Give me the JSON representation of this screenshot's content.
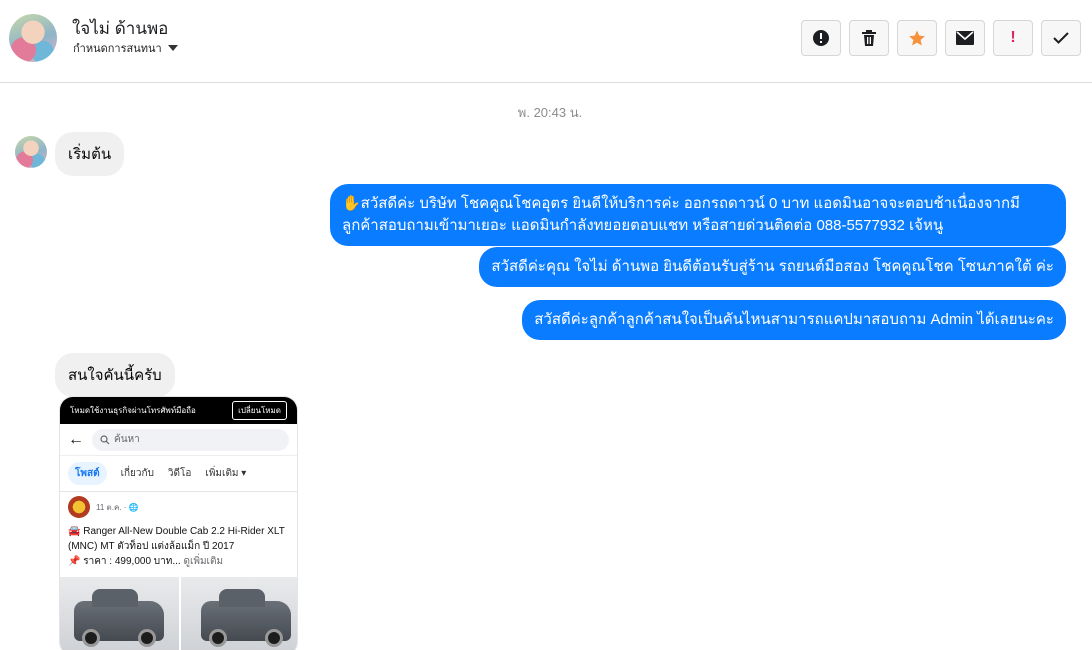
{
  "header": {
    "name": "ใจไม่ ด้านพอ",
    "assign_label": "กำหนดการสนทนา",
    "buttons": [
      {
        "id": "spam",
        "icon": "alert-circle-icon"
      },
      {
        "id": "delete",
        "icon": "trash-icon"
      },
      {
        "id": "star",
        "icon": "star-icon"
      },
      {
        "id": "mail",
        "icon": "envelope-icon"
      },
      {
        "id": "important",
        "icon": "exclamation-icon"
      },
      {
        "id": "done",
        "icon": "check-icon"
      }
    ],
    "star_color": "#f7923a",
    "important_color": "#e0245e"
  },
  "conversation": {
    "timestamp": "พ. 20:43 น.",
    "messages": [
      {
        "from": "customer",
        "text": "เริ่มต้น"
      },
      {
        "from": "page",
        "text": "✋สวัสดีค่ะ บริษัท โชคคูณโชคอุตร ยินดีให้บริการค่ะ ออกรถดาวน์ 0 บาท แอดมินอาจจะตอบช้าเนื่องจากมีลูกค้าสอบถามเข้ามาเยอะ แอดมินกำลังทยอยตอบแชท หรือสายด่วนติดต่อ 088-5577932 เจ้หนู"
      },
      {
        "from": "page",
        "text": "สวัสดีค่ะคุณ ใจไม่ ด้านพอ ยินดีต้อนรับสู่ร้าน รถยนต์มือสอง โชคคูณโชค โซนภาคใต้ ค่ะ"
      },
      {
        "from": "page",
        "text": "สวัสดีค่ะลูกค้าลูกค้าสนใจเป็นคันไหนสามารถแคปมาสอบถาม Admin ได้เลยนะคะ"
      },
      {
        "from": "customer",
        "text": "สนใจคันนี้ครับ"
      }
    ],
    "bubble_color_out": "#0a7cff",
    "bubble_color_in": "#f0f0f0"
  },
  "attachment": {
    "topbar_text": "โหมดใช้งานธุรกิจผ่านโทรศัพท์มือถือ",
    "topbar_button": "เปลี่ยนโหมด",
    "search_placeholder": "ค้นหา",
    "tabs": [
      "โพสต์",
      "เกี่ยวกับ",
      "วิดีโอ",
      "เพิ่มเติม"
    ],
    "post_date": "11 ต.ค. · ",
    "post_line1": "🚘 Ranger All-New Double Cab 2.2 Hi-Rider XLT (MNC) MT ตัวท็อป แต่งล้อแม็ก ปี 2017",
    "post_line2": "📌 ราคา : 499,000 บาท...",
    "post_more": " ดูเพิ่มเติม"
  }
}
